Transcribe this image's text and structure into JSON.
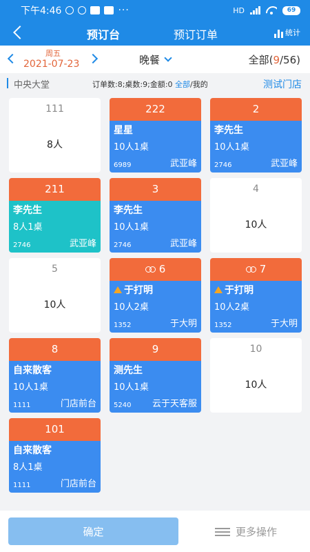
{
  "status_bar": {
    "time": "下午4:46",
    "dots": "···",
    "network": "HD",
    "battery": "69"
  },
  "nav": {
    "tabs": [
      {
        "label": "预订台"
      },
      {
        "label": "预订订单"
      }
    ],
    "stats_label": "统计"
  },
  "date_bar": {
    "weekday": "周五",
    "date": "2021-07-23",
    "meal": "晚餐",
    "scope_prefix": "全部(",
    "scope_count": "9",
    "scope_suffix": "/56)"
  },
  "section": {
    "title": "中央大堂",
    "summary_text": "订单数:8;桌数:9;金额:0 ",
    "filter_all": "全部",
    "filter_mine": "/我的",
    "store_link": "测试门店"
  },
  "tables": [
    {
      "no": "111",
      "status": "empty",
      "capacity": "8人"
    },
    {
      "no": "222",
      "status": "booked",
      "guest": "星星",
      "detail": "10人1桌",
      "code": "6989",
      "staff": "武亚峰"
    },
    {
      "no": "2",
      "status": "booked",
      "guest": "李先生",
      "detail": "10人1桌",
      "code": "2746",
      "staff": "武亚峰"
    },
    {
      "no": "211",
      "status": "booked-teal",
      "guest": "李先生",
      "detail": "8人1桌",
      "code": "2746",
      "staff": "武亚峰"
    },
    {
      "no": "3",
      "status": "booked",
      "guest": "李先生",
      "detail": "10人1桌",
      "code": "2746",
      "staff": "武亚峰"
    },
    {
      "no": "4",
      "status": "empty",
      "capacity": "10人"
    },
    {
      "no": "5",
      "status": "empty",
      "capacity": "10人"
    },
    {
      "no": "6",
      "status": "linked",
      "guest": "于打明",
      "detail": "10人2桌",
      "code": "1352",
      "staff": "于大明"
    },
    {
      "no": "7",
      "status": "linked",
      "guest": "于打明",
      "detail": "10人2桌",
      "code": "1352",
      "staff": "于大明"
    },
    {
      "no": "8",
      "status": "booked",
      "guest": "自来散客",
      "detail": "10人1桌",
      "code": "1111",
      "staff": "门店前台"
    },
    {
      "no": "9",
      "status": "booked",
      "guest": "测先生",
      "detail": "10人1桌",
      "code": "5240",
      "staff": "云于天客服"
    },
    {
      "no": "10",
      "status": "empty",
      "capacity": "10人"
    },
    {
      "no": "101",
      "status": "booked",
      "guest": "自来散客",
      "detail": "8人1桌",
      "code": "1111",
      "staff": "门店前台"
    }
  ],
  "bottom": {
    "confirm_label": "确定",
    "more_label": "更多操作"
  },
  "colors": {
    "header": "#1f8ae6",
    "booked_head": "#f26b3b",
    "booked_body": "#3b8cf0",
    "teal_body": "#1ec2c8",
    "accent_text": "#e2653a"
  }
}
